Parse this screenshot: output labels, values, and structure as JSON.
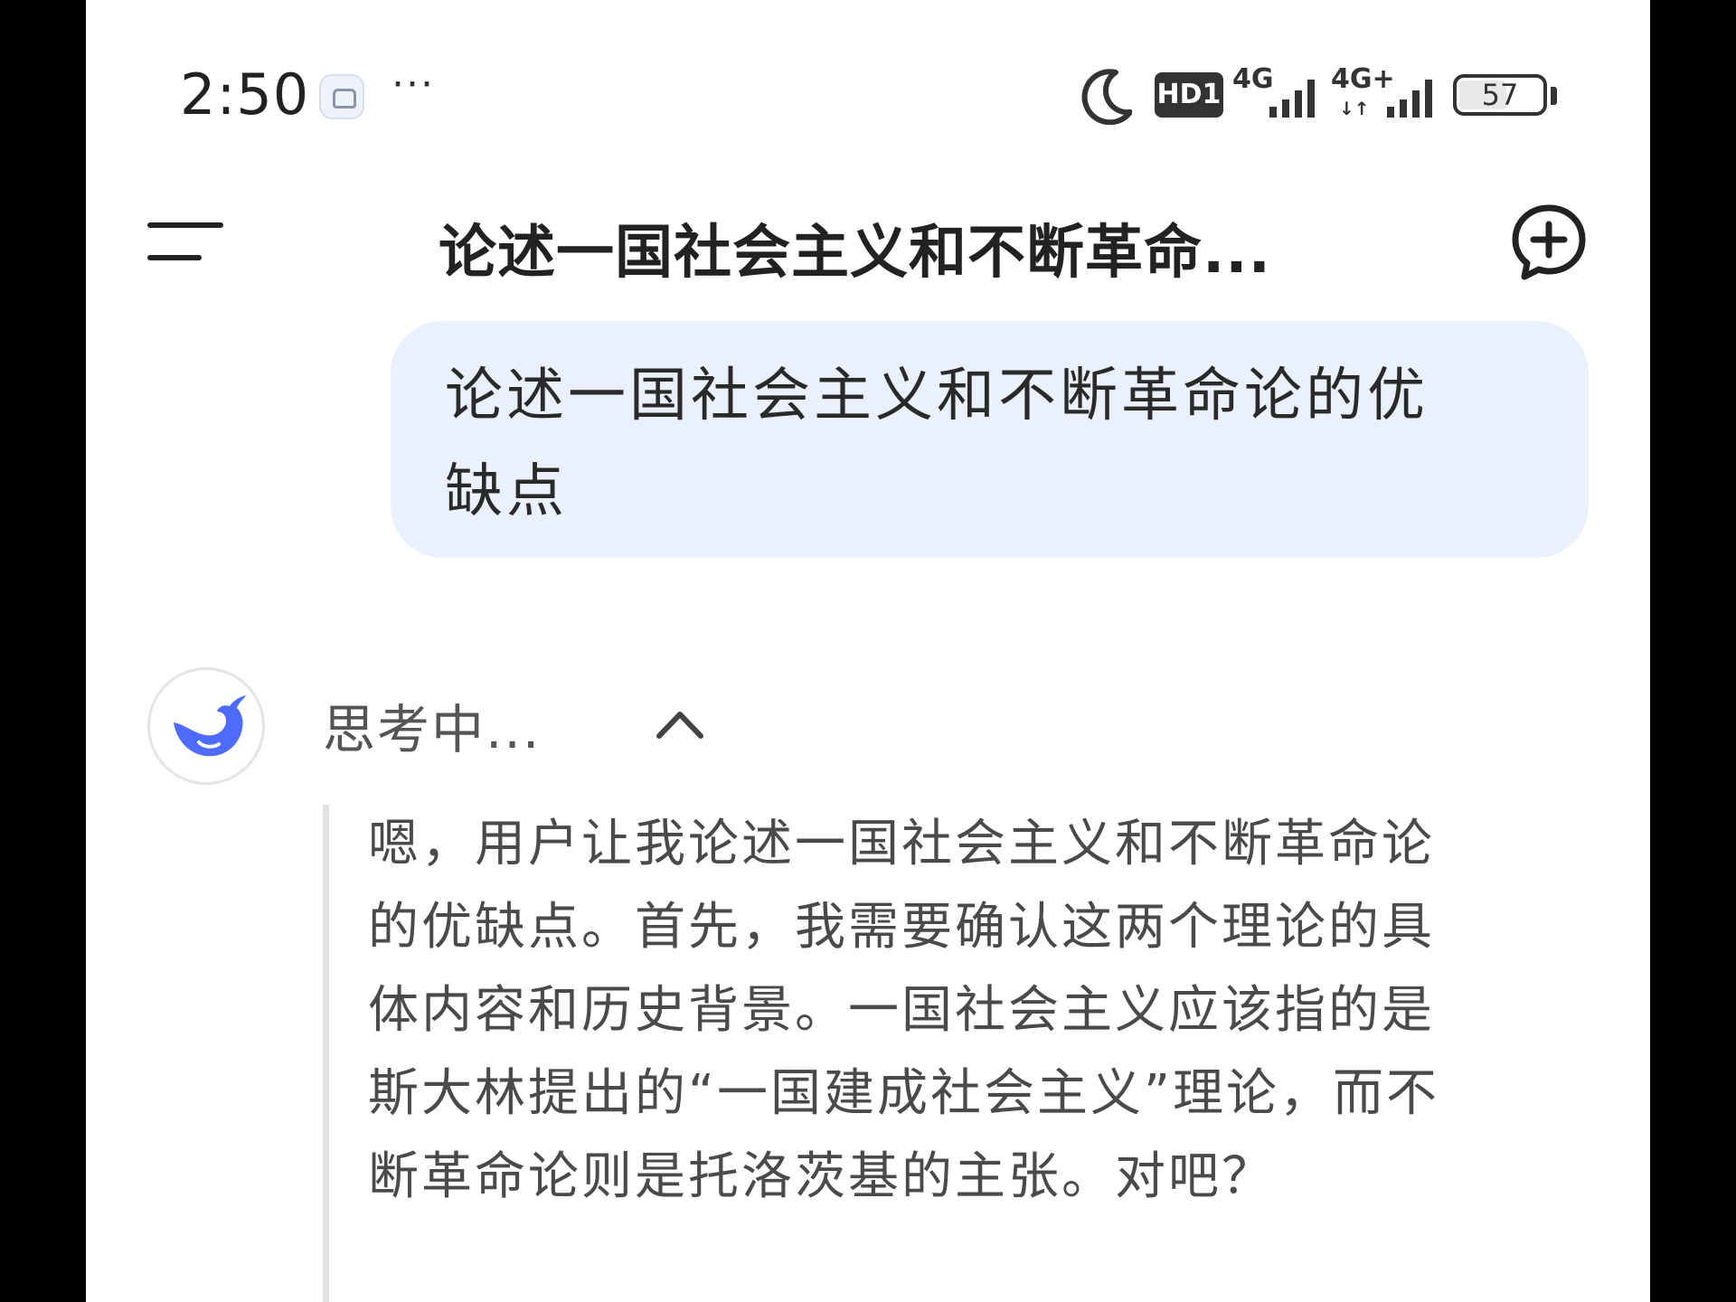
{
  "status_bar": {
    "time": "2:50",
    "more": "···",
    "hd_badge": "HD1",
    "network_1": "4G",
    "network_2": "4G+",
    "battery": "57",
    "icons": [
      "app-notification-icon",
      "moon-icon",
      "signal-icon",
      "signal-icon",
      "battery-icon"
    ]
  },
  "header": {
    "title": "论述一国社会主义和不断革命...",
    "menu_icon": "menu-icon",
    "new_chat_icon": "new-chat-plus-icon"
  },
  "user_message": {
    "line1": "论述一国社会主义和不断革命论的优",
    "line2": "缺点"
  },
  "assistant": {
    "avatar_icon": "deepseek-whale-icon",
    "thinking_label": "思考中...",
    "thinking_lines": [
      "嗯，用户让我论述一国社会主义和不断革命论",
      "的优缺点。首先，我需要确认这两个理论的具",
      "体内容和历史背景。一国社会主义应该指的是",
      "斯大林提出的“一国建成社会主义”理论，而不",
      "断革命论则是托洛茨基的主张。对吧？"
    ]
  },
  "colors": {
    "bubble": "#eaf1fd",
    "accent": "#4d6bfe",
    "text": "#222222",
    "muted": "#4a4a4a"
  }
}
